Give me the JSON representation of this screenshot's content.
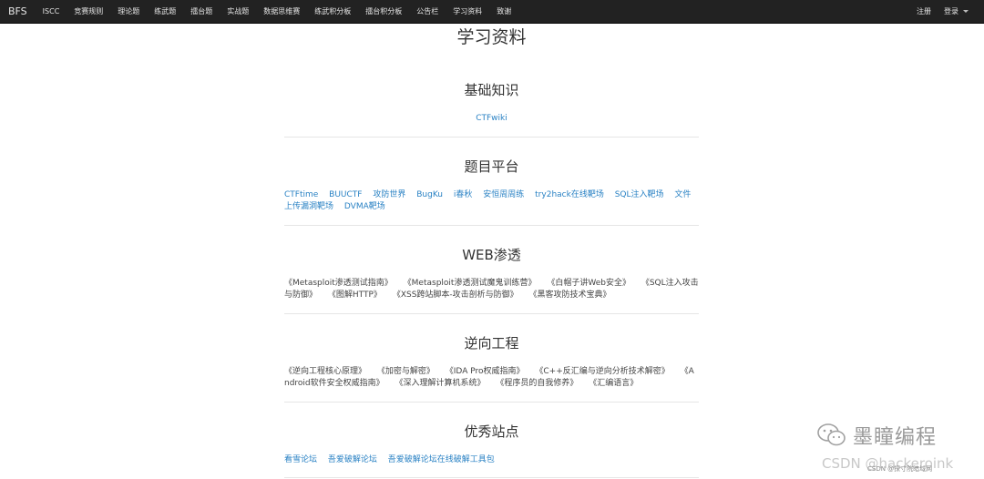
{
  "navbar": {
    "brand": "BFS",
    "items": [
      {
        "label": "ISCC"
      },
      {
        "label": "竞赛规则"
      },
      {
        "label": "理论题"
      },
      {
        "label": "练武题"
      },
      {
        "label": "擂台题"
      },
      {
        "label": "实战题"
      },
      {
        "label": "数据思维赛"
      },
      {
        "label": "练武积分板"
      },
      {
        "label": "擂台积分板"
      },
      {
        "label": "公告栏"
      },
      {
        "label": "学习资料"
      },
      {
        "label": "致谢"
      }
    ],
    "register_label": "注册",
    "login_label": "登录"
  },
  "page": {
    "title": "学习资料"
  },
  "sections": [
    {
      "title": "基础知识",
      "links": [
        "CTFwiki"
      ]
    },
    {
      "title": "题目平台",
      "links": [
        "CTFtime",
        "BUUCTF",
        "攻防世界",
        "BugKu",
        "i春秋",
        "安恒周周练",
        "try2hack在线靶场",
        "SQL注入靶场",
        "文件上传漏洞靶场",
        "DVMA靶场"
      ]
    },
    {
      "title": "WEB渗透",
      "books": [
        "《Metasploit渗透测试指南》",
        "《Metasploit渗透测试魔鬼训练营》",
        "《白帽子讲Web安全》",
        "《SQL注入攻击与防御》",
        "《图解HTTP》",
        "《XSS跨站脚本-攻击剖析与防御》",
        "《黑客攻防技术宝典》"
      ]
    },
    {
      "title": "逆向工程",
      "books": [
        "《逆向工程核心原理》",
        "《加密与解密》",
        "《IDA Pro权威指南》",
        "《C++反汇编与逆向分析技术解密》",
        "《Android软件安全权威指南》",
        "《深入理解计算机系统》",
        "《程序员的自我修养》",
        "《汇编语言》"
      ]
    },
    {
      "title": "优秀站点",
      "links": [
        "看雪论坛",
        "吾爱破解论坛",
        "吾爱破解论坛在线破解工具包"
      ]
    }
  ],
  "watermark": {
    "brand_text": "墨瞳编程",
    "csdn_text": "CSDN @hackeroink",
    "small_text": "CSDN @探寸院暗域网"
  },
  "colors": {
    "navbar_bg": "#222222",
    "link": "#2a82c4"
  }
}
